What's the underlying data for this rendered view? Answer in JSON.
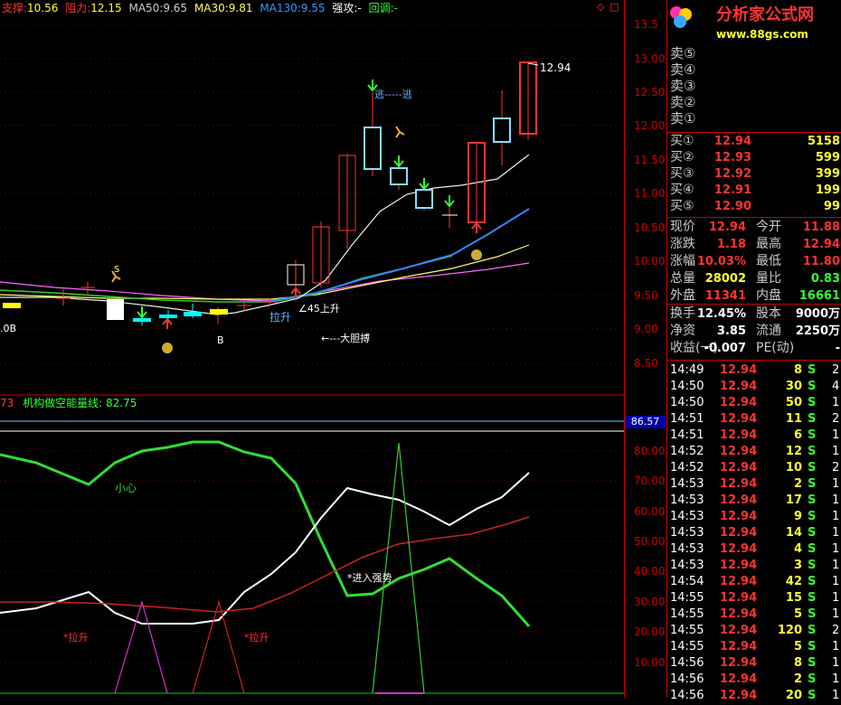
{
  "header": {
    "support_label": "支撑:",
    "support_value": "10.56",
    "resistance_label": "阻力:",
    "resistance_value": "12.15",
    "ma50_label": "MA50:",
    "ma50_value": "9.65",
    "ma30_label": "MA30:",
    "ma30_value": "9.81",
    "ma130_label": "MA130:",
    "ma130_value": "9.55",
    "strong_label": "强攻:",
    "strong_value": "-",
    "pullback_label": "回调:",
    "pullback_value": "-"
  },
  "logo": {
    "title": "分析家公式网",
    "url": "www.88gs.com"
  },
  "price_axis": [
    "13.5",
    "13.00",
    "12.50",
    "12.00",
    "11.50",
    "11.00",
    "10.50",
    "10.00",
    "9.50",
    "9.00",
    "8.50"
  ],
  "indicator_axis": [
    "80.00",
    "70.00",
    "60.00",
    "50.00",
    "40.00",
    "30.00",
    "20.00",
    "10.00"
  ],
  "indicator_marker": "86.57",
  "indicator_header": {
    "prefix": "73",
    "name": "机构做空能量线:",
    "value": "82.75"
  },
  "annotations": {
    "escape": "逃-----逃",
    "rise_angle": "∠45上升",
    "pull_up_1": "拉升",
    "bold_fight": "←---大胆搏",
    "b1": "B",
    "b2": "B",
    "b_left": ".0B",
    "s_mark": "S",
    "last_price": "12.94",
    "careful": "小心",
    "enter_strong": "*进入强势",
    "pull_up_2": "*拉升",
    "pull_up_3": "*拉升"
  },
  "colors": {
    "up": "#ff3333",
    "down": "#00ffff",
    "flat": "#ffffff",
    "grid": "#aa0000"
  },
  "quote": {
    "sells": [
      {
        "label": "卖⑤",
        "price": "",
        "vol": ""
      },
      {
        "label": "卖④",
        "price": "",
        "vol": ""
      },
      {
        "label": "卖③",
        "price": "",
        "vol": ""
      },
      {
        "label": "卖②",
        "price": "",
        "vol": ""
      },
      {
        "label": "卖①",
        "price": "",
        "vol": ""
      }
    ],
    "buys": [
      {
        "label": "买①",
        "price": "12.94",
        "vol": "5158"
      },
      {
        "label": "买②",
        "price": "12.93",
        "vol": "599"
      },
      {
        "label": "买③",
        "price": "12.92",
        "vol": "399"
      },
      {
        "label": "买④",
        "price": "12.91",
        "vol": "199"
      },
      {
        "label": "买⑤",
        "price": "12.90",
        "vol": "99"
      }
    ],
    "stats": [
      {
        "l1": "现价",
        "v1": "12.94",
        "l2": "今开",
        "v2": "11.88"
      },
      {
        "l1": "涨跌",
        "v1": "1.18",
        "l2": "最高",
        "v2": "12.94"
      },
      {
        "l1": "涨幅",
        "v1": "10.03%",
        "l2": "最低",
        "v2": "11.80"
      },
      {
        "l1": "总量",
        "v1": "28002",
        "l2": "量比",
        "v2": "0.83"
      },
      {
        "l1": "外盘",
        "v1": "11341",
        "l2": "内盘",
        "v2": "16661"
      }
    ],
    "fundamentals": [
      {
        "l1": "换手",
        "v1": "12.45%",
        "l2": "股本",
        "v2": "9000万"
      },
      {
        "l1": "净资",
        "v1": "3.85",
        "l2": "流通",
        "v2": "2250万"
      },
      {
        "l1": "收益(一)",
        "v1": "-0.007",
        "l2": "PE(动)",
        "v2": "-"
      }
    ],
    "ticks": [
      {
        "time": "14:49",
        "price": "12.94",
        "vol": "8",
        "side": "S",
        "n": "2"
      },
      {
        "time": "14:50",
        "price": "12.94",
        "vol": "30",
        "side": "S",
        "n": "4"
      },
      {
        "time": "14:50",
        "price": "12.94",
        "vol": "50",
        "side": "S",
        "n": "1"
      },
      {
        "time": "14:51",
        "price": "12.94",
        "vol": "11",
        "side": "S",
        "n": "2"
      },
      {
        "time": "14:51",
        "price": "12.94",
        "vol": "6",
        "side": "S",
        "n": "1"
      },
      {
        "time": "14:52",
        "price": "12.94",
        "vol": "12",
        "side": "S",
        "n": "1"
      },
      {
        "time": "14:52",
        "price": "12.94",
        "vol": "10",
        "side": "S",
        "n": "2"
      },
      {
        "time": "14:53",
        "price": "12.94",
        "vol": "2",
        "side": "S",
        "n": "1"
      },
      {
        "time": "14:53",
        "price": "12.94",
        "vol": "17",
        "side": "S",
        "n": "1"
      },
      {
        "time": "14:53",
        "price": "12.94",
        "vol": "9",
        "side": "S",
        "n": "1"
      },
      {
        "time": "14:53",
        "price": "12.94",
        "vol": "14",
        "side": "S",
        "n": "1"
      },
      {
        "time": "14:53",
        "price": "12.94",
        "vol": "4",
        "side": "S",
        "n": "1"
      },
      {
        "time": "14:53",
        "price": "12.94",
        "vol": "3",
        "side": "S",
        "n": "1"
      },
      {
        "time": "14:54",
        "price": "12.94",
        "vol": "42",
        "side": "S",
        "n": "1"
      },
      {
        "time": "14:55",
        "price": "12.94",
        "vol": "15",
        "side": "S",
        "n": "1"
      },
      {
        "time": "14:55",
        "price": "12.94",
        "vol": "5",
        "side": "S",
        "n": "1"
      },
      {
        "time": "14:55",
        "price": "12.94",
        "vol": "120",
        "side": "S",
        "n": "2"
      },
      {
        "time": "14:55",
        "price": "12.94",
        "vol": "5",
        "side": "S",
        "n": "1"
      },
      {
        "time": "14:56",
        "price": "12.94",
        "vol": "8",
        "side": "S",
        "n": "1"
      },
      {
        "time": "14:56",
        "price": "12.94",
        "vol": "2",
        "side": "S",
        "n": "1"
      },
      {
        "time": "14:56",
        "price": "12.94",
        "vol": "20",
        "side": "S",
        "n": "1"
      }
    ]
  }
}
